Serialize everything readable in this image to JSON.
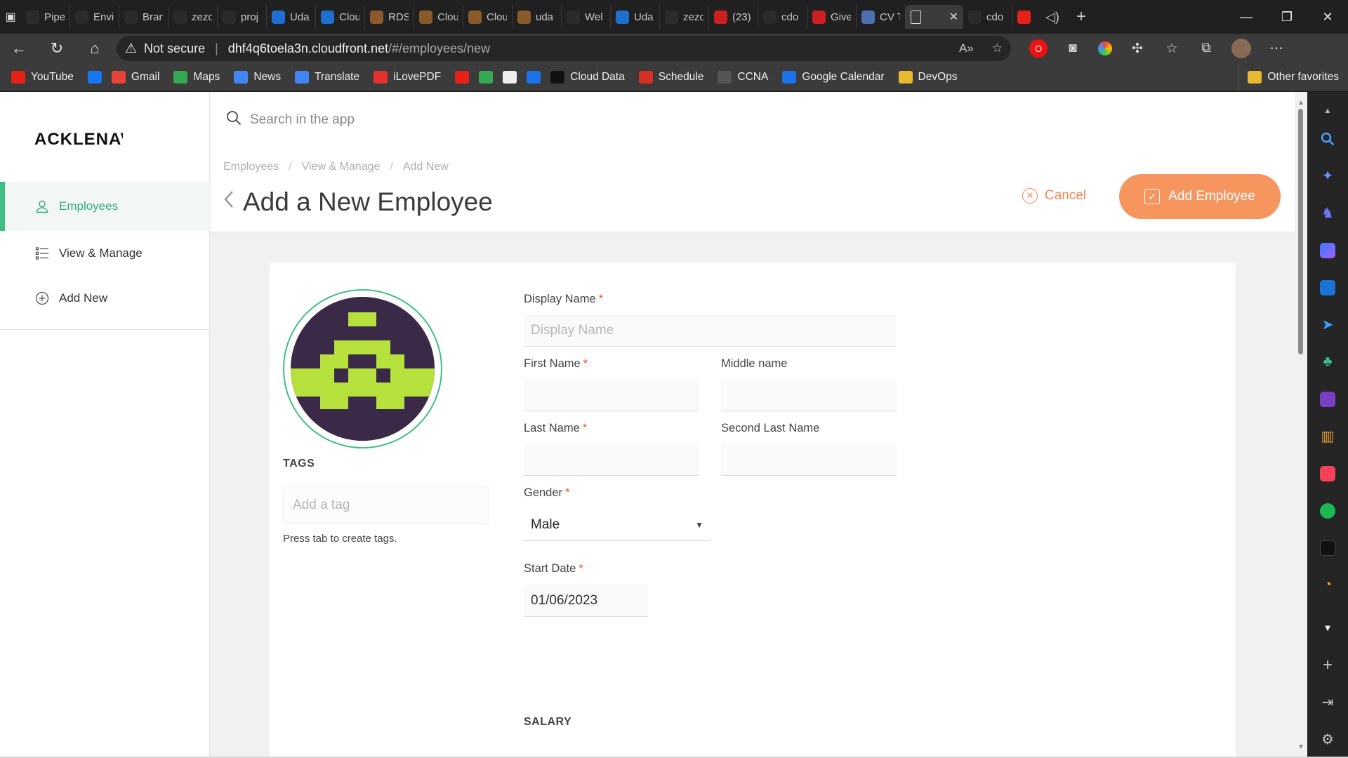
{
  "browser": {
    "tabs": [
      {
        "label": "Pipe",
        "icon": "pipedream-icon",
        "color": "#2b2b2b"
      },
      {
        "label": "Envi",
        "icon": "circle-icon",
        "color": "#2b2b2b"
      },
      {
        "label": "Bran",
        "icon": "github-icon",
        "color": "#2b2b2b"
      },
      {
        "label": "zezo",
        "icon": "github-icon",
        "color": "#2b2b2b"
      },
      {
        "label": "proj",
        "icon": "github-icon",
        "color": "#2b2b2b"
      },
      {
        "label": "Uda",
        "icon": "udacity-icon",
        "color": "#1f6fd0"
      },
      {
        "label": "Clou",
        "icon": "udacity-icon",
        "color": "#1f6fd0"
      },
      {
        "label": "RDS",
        "icon": "box-icon",
        "color": "#8a5a2b"
      },
      {
        "label": "Clou",
        "icon": "box-icon",
        "color": "#8a5a2b"
      },
      {
        "label": "Clou",
        "icon": "box-icon",
        "color": "#8a5a2b"
      },
      {
        "label": "uda",
        "icon": "box-icon",
        "color": "#8a5a2b"
      },
      {
        "label": "Wel",
        "icon": "page-icon",
        "color": "#2b2b2b"
      },
      {
        "label": "Uda",
        "icon": "udacity-icon",
        "color": "#1f6fd0"
      },
      {
        "label": "zezo",
        "icon": "github-icon",
        "color": "#2b2b2b"
      },
      {
        "label": "(23)",
        "icon": "youtube-icon",
        "color": "#cc2020"
      },
      {
        "label": "cdo",
        "icon": "github-icon",
        "color": "#2b2b2b"
      },
      {
        "label": "Give",
        "icon": "youtube-icon",
        "color": "#cc2020"
      },
      {
        "label": "CV T",
        "icon": "docs-icon",
        "color": "#4d6fb0"
      }
    ],
    "active_tab": {
      "label": "",
      "icon": "page-icon",
      "close": "✕"
    },
    "after_tabs": [
      {
        "label": "cdo",
        "icon": "github-icon",
        "color": "#2b2b2b"
      }
    ],
    "new_tab": "+",
    "address": {
      "security": "Not secure",
      "host": "dhf4q6toela3n.cloudfront.net",
      "path": "/#/employees/new"
    },
    "favorites": [
      {
        "label": "YouTube",
        "icon": "youtube-icon",
        "color": "#e62117"
      },
      {
        "label": "",
        "icon": "facebook-icon",
        "color": "#1877f2"
      },
      {
        "label": "Gmail",
        "icon": "gmail-icon",
        "color": "#e84335"
      },
      {
        "label": "Maps",
        "icon": "maps-icon",
        "color": "#34a853"
      },
      {
        "label": "News",
        "icon": "news-icon",
        "color": "#4285f4"
      },
      {
        "label": "Translate",
        "icon": "translate-icon",
        "color": "#4285f4"
      },
      {
        "label": "iLovePDF",
        "icon": "ilovepdf-icon",
        "color": "#e5322d"
      },
      {
        "label": "",
        "icon": "youtube-music-icon",
        "color": "#e62117"
      },
      {
        "label": "",
        "icon": "meet-icon",
        "color": "#34a853"
      },
      {
        "label": "",
        "icon": "calculator-icon",
        "color": "#eeeeee"
      },
      {
        "label": "",
        "icon": "c-icon",
        "color": "#1a73e8"
      },
      {
        "label": "Cloud Data",
        "icon": "cloud-data-icon",
        "color": "#111111"
      },
      {
        "label": "Schedule",
        "icon": "pdf-icon",
        "color": "#d93025"
      },
      {
        "label": "CCNA",
        "icon": "cisco-icon",
        "color": "#555555"
      },
      {
        "label": "Google Calendar",
        "icon": "calendar-icon",
        "color": "#1a73e8"
      },
      {
        "label": "DevOps",
        "icon": "folder-icon",
        "color": "#e8b830"
      }
    ],
    "other_favorites": "Other favorites"
  },
  "app": {
    "logo": "ACKLENAV",
    "search_placeholder": "Search in the app",
    "menu": [
      {
        "label": "Employees",
        "icon": "user-icon"
      },
      {
        "label": "View & Manage",
        "icon": "list-icon"
      },
      {
        "label": "Add New",
        "icon": "plus-circle-icon"
      }
    ],
    "breadcrumbs": [
      "Employees",
      "View & Manage",
      "Add New"
    ],
    "page_title": "Add a New Employee",
    "cancel_label": "Cancel",
    "add_label": "Add Employee",
    "tags": {
      "heading": "TAGS",
      "placeholder": "Add a tag",
      "hint": "Press tab to create tags."
    },
    "form": {
      "display_name": {
        "label": "Display Name",
        "placeholder": "Display Name",
        "required": "*"
      },
      "first_name": {
        "label": "First Name",
        "value": "",
        "required": "*"
      },
      "middle_name": {
        "label": "Middle name",
        "value": ""
      },
      "last_name": {
        "label": "Last Name",
        "value": "",
        "required": "*"
      },
      "second_last_name": {
        "label": "Second Last Name",
        "value": ""
      },
      "gender": {
        "label": "Gender",
        "value": "Male",
        "required": "*"
      },
      "start_date": {
        "label": "Start Date",
        "value": "01/06/2023",
        "required": "*"
      },
      "salary_heading": "SALARY"
    }
  },
  "colors": {
    "accent_green": "#3fbf86",
    "accent_orange": "#f7955f",
    "required_red": "#e9573e"
  }
}
